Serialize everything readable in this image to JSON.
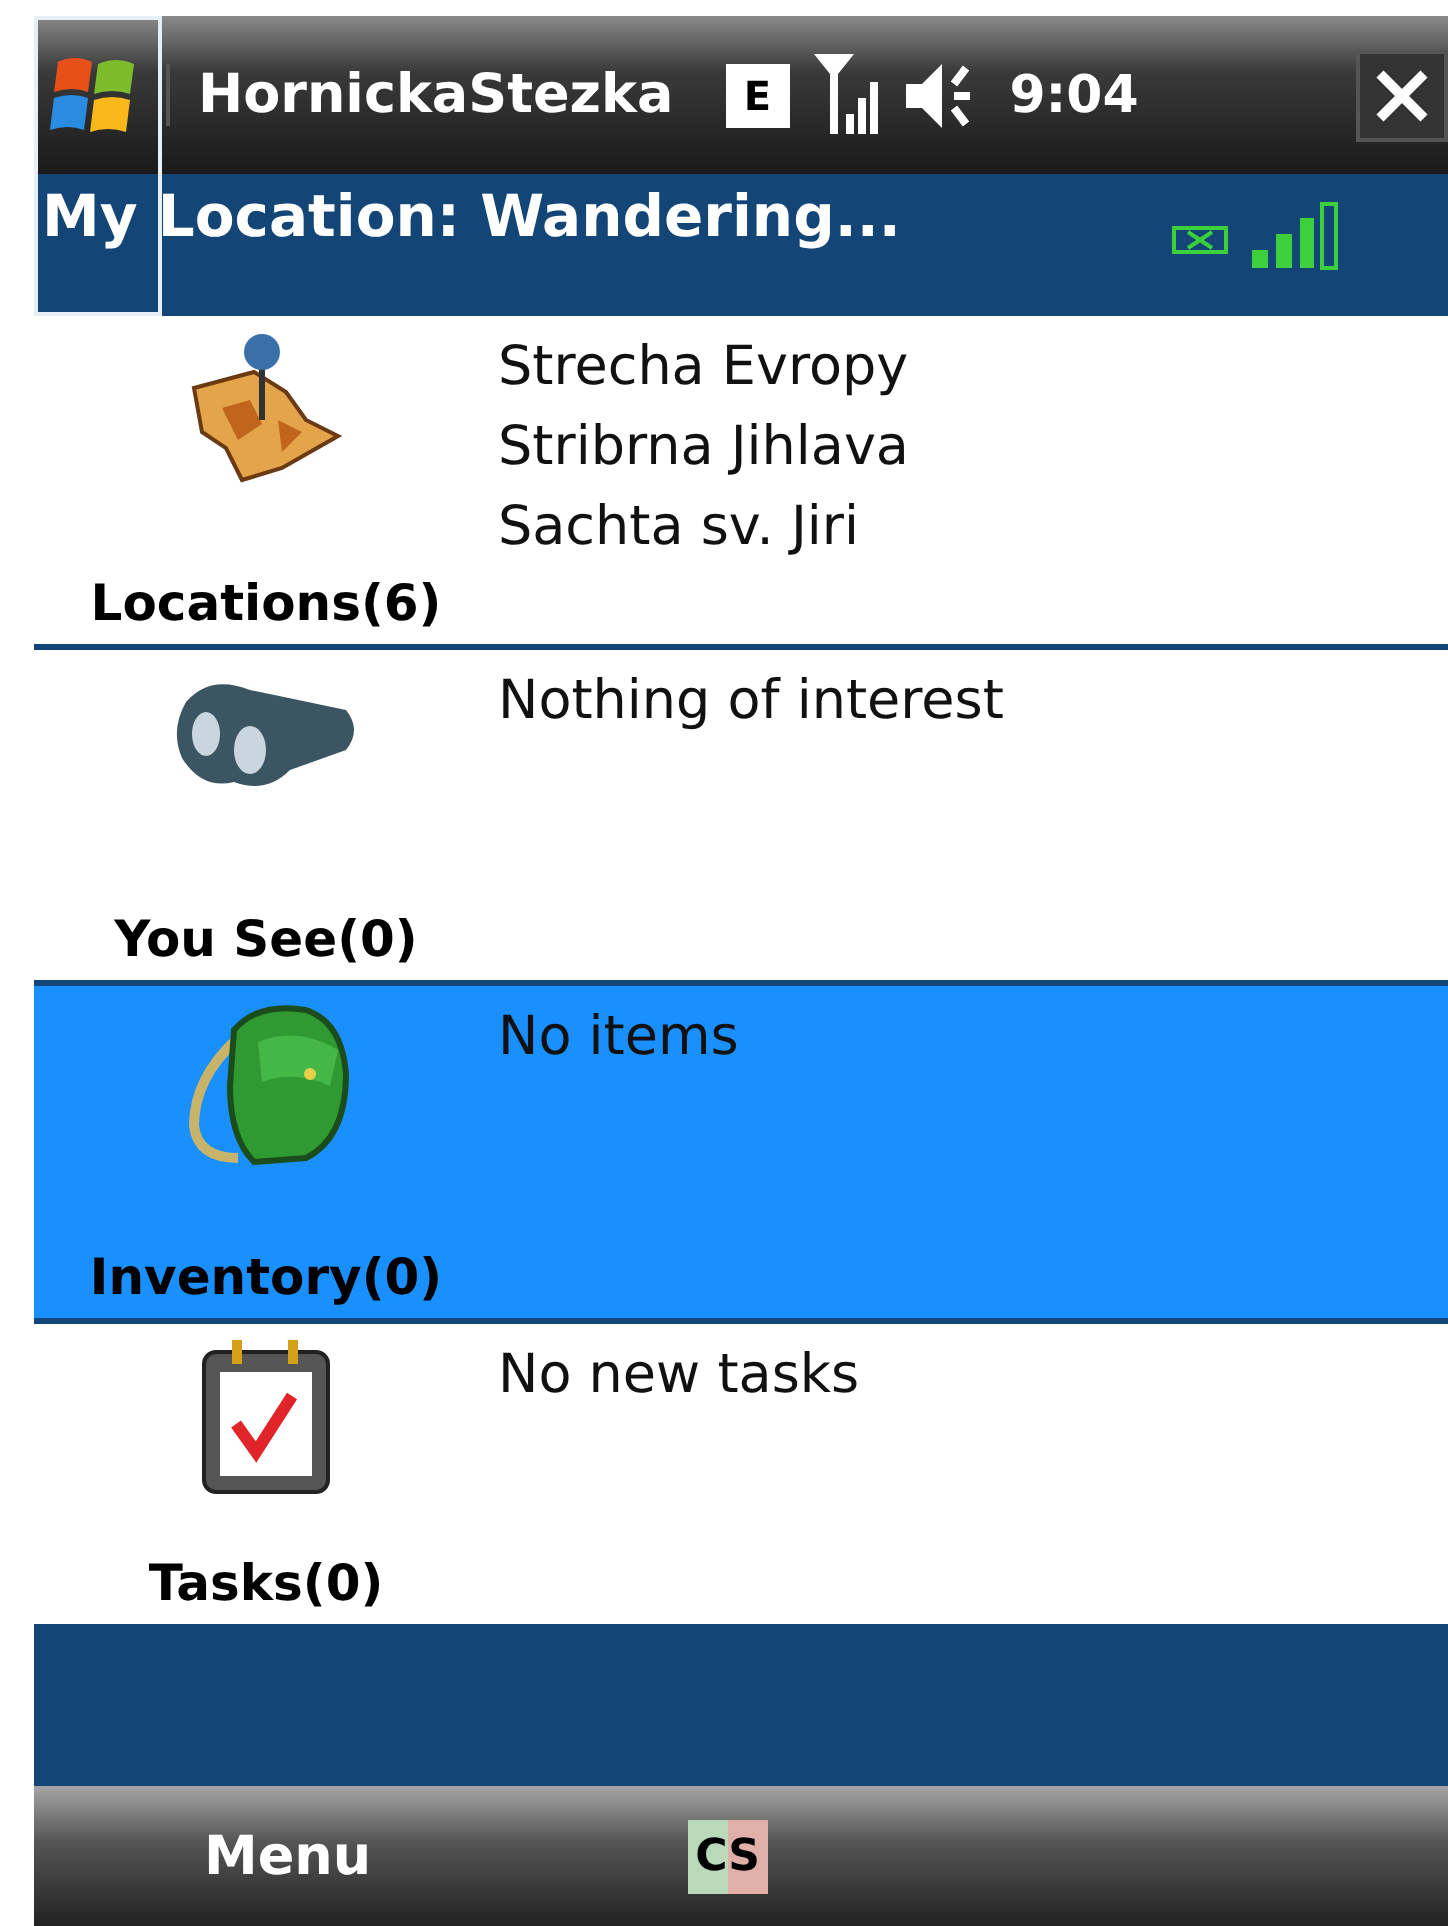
{
  "title_bar": {
    "app_title": "HornickaStezka",
    "network_badge": "E",
    "time": "9:04"
  },
  "location_bar": {
    "label": "My Location: Wandering..."
  },
  "sections": [
    {
      "kind": "locations",
      "label": "Locations(6)",
      "selected": false,
      "lines": [
        "Strecha Evropy",
        "Stribrna Jihlava",
        "Sachta sv. Jiri"
      ]
    },
    {
      "kind": "you_see",
      "label": "You See(0)",
      "selected": false,
      "lines": [
        "Nothing of interest"
      ]
    },
    {
      "kind": "inventory",
      "label": "Inventory(0)",
      "selected": true,
      "lines": [
        "No items"
      ]
    },
    {
      "kind": "tasks",
      "label": "Tasks(0)",
      "selected": false,
      "lines": [
        "No new tasks"
      ]
    }
  ],
  "soft_keys": {
    "left": "Menu",
    "input_mode": "CS"
  }
}
